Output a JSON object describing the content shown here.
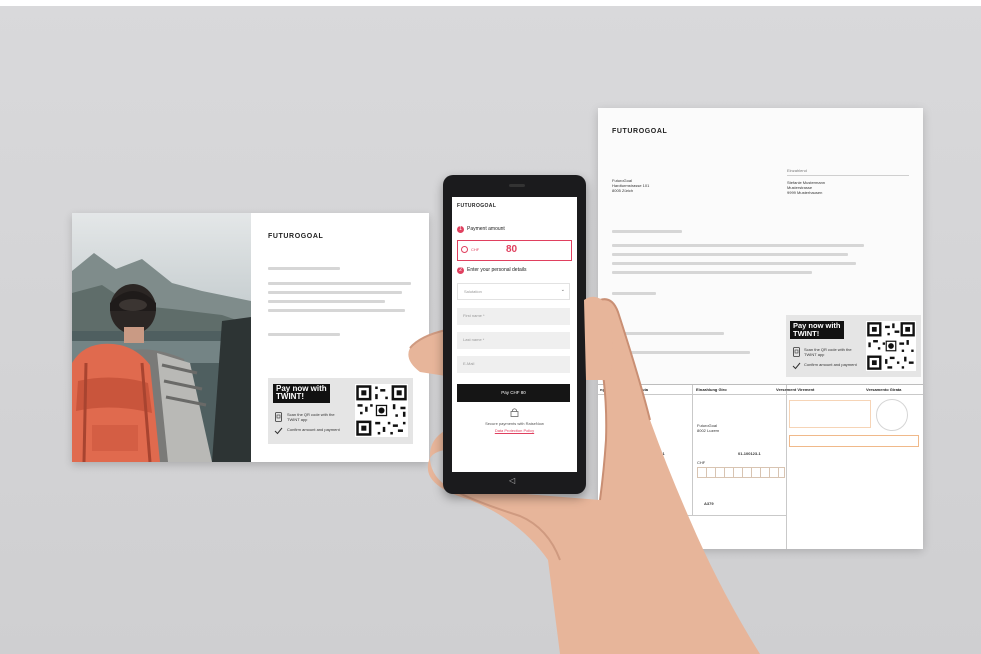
{
  "postcard": {
    "brand": "FUTUROGOAL",
    "twint_title_line1": "Pay now with",
    "twint_title_line2": "TWINT!",
    "twint_step1": "Scan the QR code with the TWINT app",
    "twint_step2": "Confirm amount and payment"
  },
  "phone": {
    "brand": "FUTUROGOAL",
    "step1_number": "1",
    "step1_label": "Payment amount",
    "currency": "CHF",
    "amount": "80",
    "step2_number": "2",
    "step2_label": "Enter your personal details",
    "salutation_placeholder": "Salutation",
    "salutation_caret": "⌄",
    "firstname_placeholder": "First name *",
    "lastname_placeholder": "Last name *",
    "email_placeholder": "E-Mail",
    "pay_button": "Pay CHF 80",
    "lock_icon": "lock-icon",
    "secure_text": "Secure payments with RaiseNow",
    "privacy_link": "Data Protection Policy"
  },
  "invoice": {
    "brand": "FUTUROGOAL",
    "recipient_label": "Einzahlend",
    "sender_address": [
      "FuturoGoal",
      "Hardturmstrasse 101",
      "8005 Zürich"
    ],
    "recipient_address": [
      "Stefanie Mustermann",
      "Musterstrasse",
      "9999 Musterhausen"
    ],
    "twint_title_line1": "Pay now with",
    "twint_title_line2": "TWINT!",
    "twint_step1": "Scan the QR code with the TWINT app",
    "twint_step2": "Confirm amount and payment",
    "slip_col1": "ng / Récépissé / Ricevuta",
    "slip_col2": "Einzahlung Giro",
    "slip_col3": "Versement Virement",
    "slip_col4": "Versamento Girata",
    "slip_payee": [
      "FuturoGoal",
      "8002 Luzern"
    ],
    "slip_account": "01-100123-1",
    "slip_account_left": "90123-1",
    "slip_chf": "CHF",
    "slip_code": "A379"
  },
  "colors": {
    "accent": "#e0405f",
    "slip_orange": "#e3954a",
    "background": "#d6d6d8"
  }
}
